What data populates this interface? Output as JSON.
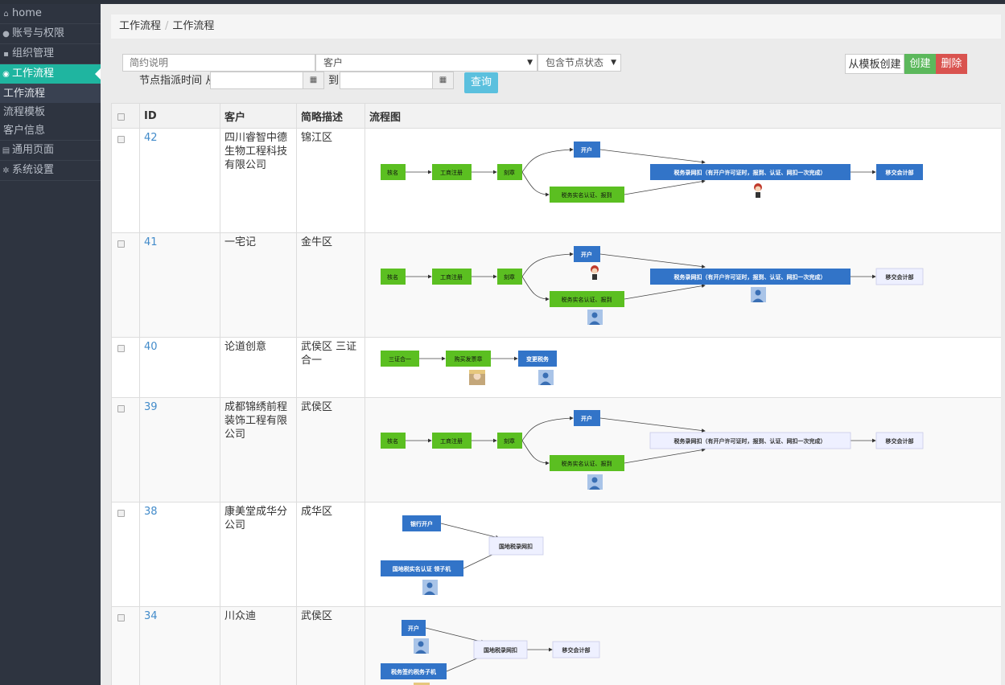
{
  "sidebar": {
    "items": [
      {
        "label": "home",
        "icon": "home-icon"
      },
      {
        "label": "账号与权限",
        "icon": "users-icon"
      },
      {
        "label": "组织管理",
        "icon": "sitemap-icon"
      },
      {
        "label": "工作流程",
        "icon": "eye-icon"
      },
      {
        "label": "通用页面",
        "icon": "page-icon"
      },
      {
        "label": "系统设置",
        "icon": "gear-icon"
      }
    ],
    "subitems": [
      "工作流程",
      "流程模板",
      "客户信息"
    ]
  },
  "breadcrumb": {
    "parent": "工作流程",
    "separator": "/",
    "current": "工作流程"
  },
  "filters": {
    "desc_placeholder": "简约说明",
    "customer_select": "客户",
    "status_select": "包含节点状态",
    "assign_time_label": "节点指派时间 从",
    "to_label": "到",
    "query_button": "查询"
  },
  "actions": {
    "from_template": "从模板创建",
    "create": "创建",
    "delete": "删除"
  },
  "table": {
    "columns": [
      "ID",
      "客户",
      "简略描述",
      "流程图"
    ],
    "rows": [
      {
        "id": "42",
        "customer": "四川睿智中德生物工程科技有限公司",
        "desc": "锦江区"
      },
      {
        "id": "41",
        "customer": "一宅记",
        "desc": "金牛区"
      },
      {
        "id": "40",
        "customer": "论道创意",
        "desc": "武侯区 三证合一"
      },
      {
        "id": "39",
        "customer": "成都锦绣前程装饰工程有限公司",
        "desc": "武侯区"
      },
      {
        "id": "38",
        "customer": "康美堂成华分公司",
        "desc": "成华区"
      },
      {
        "id": "34",
        "customer": "川众迪",
        "desc": "武侯区"
      }
    ]
  },
  "flows": {
    "n_mingming": "核名",
    "n_gongshang": "工商注册",
    "n_kezhang": "刻章",
    "n_kaihu": "开户",
    "n_shiming": "税务实名认证、报到",
    "n_luruwangkou": "税务录网扣（有开户许可证时，报到、认证、网扣一次完成）",
    "n_yijiao": "移交会计部",
    "n_sanzheng": "三证合一",
    "n_gouyin": "购买发票章",
    "n_biangeng": "变更税务",
    "n_yinhangkaihu": "银行开户",
    "n_guodi": "国地税录网扣",
    "n_guodi_shiming": "国地税实名认证 领子机",
    "n_shuiwu_qianyue": "税务签约税务子机"
  },
  "colors": {
    "green": "#5bbf21",
    "blue": "#3274c8",
    "pending": "#eef0ff",
    "accent": "#1fb5a0",
    "create": "#5cb85c",
    "delete": "#d9534f",
    "query": "#5bc0de"
  }
}
